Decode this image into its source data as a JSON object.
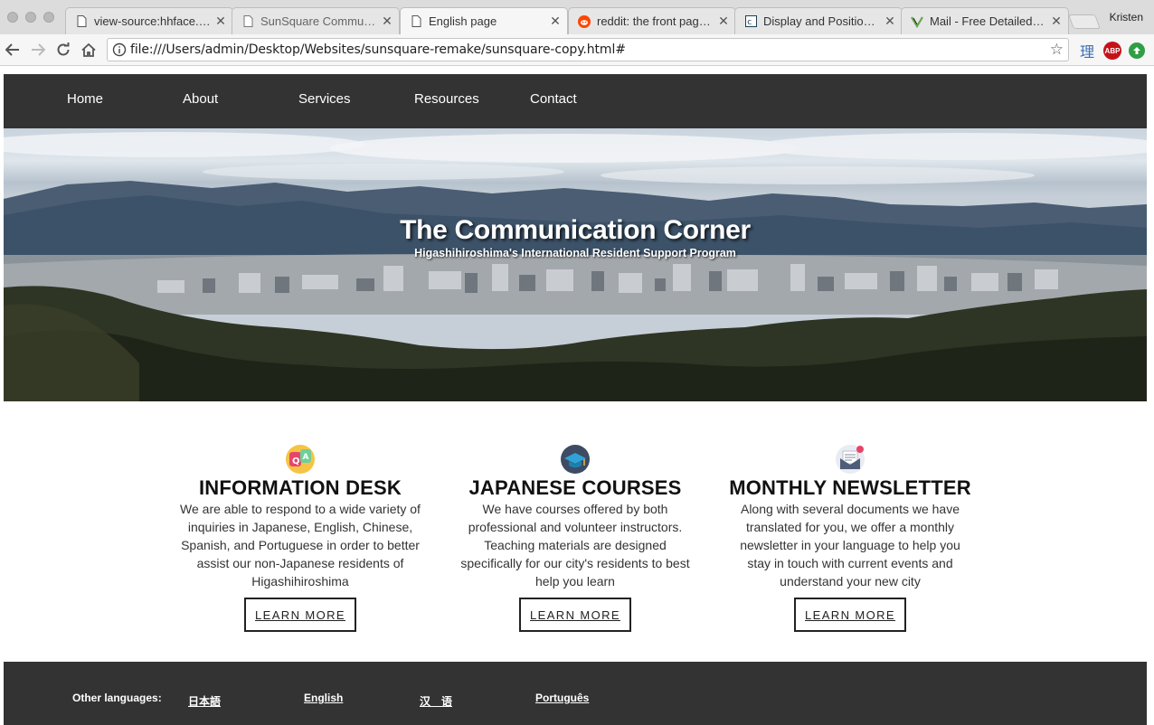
{
  "browser": {
    "tabs": [
      {
        "title": "view-source:hhface.org",
        "favicon": "page-icon"
      },
      {
        "title": "SunSquare Communication",
        "favicon": "page-icon"
      },
      {
        "title": "English page",
        "favicon": "page-icon"
      },
      {
        "title": "reddit: the front page of",
        "favicon": "reddit-icon"
      },
      {
        "title": "Display and Positioning",
        "favicon": "codecademy-icon"
      },
      {
        "title": "Mail - Free Detailed Fla",
        "favicon": "mail-icon"
      }
    ],
    "profile_name": "Kristen",
    "url": "file:///Users/admin/Desktop/Websites/sunsquare-remake/sunsquare-copy.html#",
    "extensions": [
      "理",
      "ABP"
    ]
  },
  "site": {
    "nav": [
      "Home",
      "About",
      "Services",
      "Resources",
      "Contact"
    ],
    "hero": {
      "title": "The Communication Corner",
      "subtitle": "Higashihiroshima's International Resident Support Program"
    },
    "features": [
      {
        "icon": "qa-speech-icon",
        "heading": "INFORMATION DESK",
        "text": "We are able to respond to a wide variety of inquiries in Japanese, English, Chinese, Spanish, and Portuguese in order to better assist our non-Japanese residents of Higashihiroshima",
        "button": "LEARN MORE"
      },
      {
        "icon": "graduation-cap-icon",
        "heading": "JAPANESE COURSES",
        "text": "We have courses offered by both professional and volunteer instructors. Teaching materials are designed specifically for our city's residents to best help you learn",
        "button": "LEARN MORE"
      },
      {
        "icon": "newsletter-envelope-icon",
        "heading": "MONTHLY NEWSLETTER",
        "text": "Along with several documents we have translated for you, we offer a monthly newsletter in your language to help you stay in touch with current events and understand your new city",
        "button": "LEARN MORE"
      }
    ],
    "footer": {
      "label": "Other languages:",
      "languages": [
        "日本語",
        "English",
        "汉　语",
        "Português"
      ]
    }
  },
  "colors": {
    "nav_bg": "#333333",
    "footer_bg": "#333333",
    "text": "#111111"
  }
}
